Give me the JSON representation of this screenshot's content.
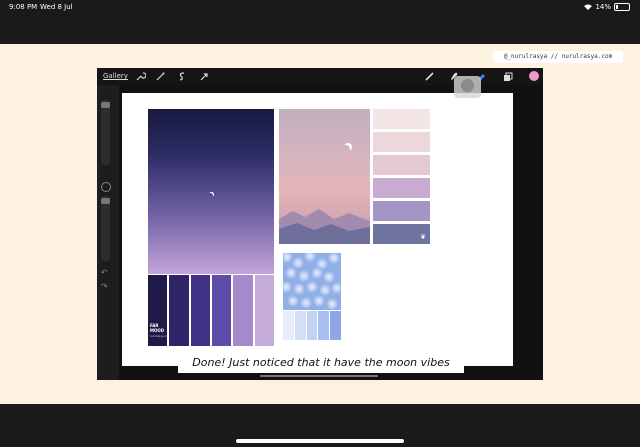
{
  "status_bar": {
    "time": "9:08 PM",
    "date": "Wed 8 Jul",
    "battery": "14%"
  },
  "credit": "@_nurulrasya // nurulrasya.com",
  "toolbar": {
    "gallery_label": "Gallery",
    "tools_left": [
      "wrench-icon",
      "magic-wand-icon",
      "selection-icon",
      "transform-arrow-icon"
    ],
    "tools_right": [
      "brush-icon",
      "smudge-icon",
      "eraser-icon",
      "layers-icon"
    ],
    "current_color": "#ec9cc9"
  },
  "moodboard": {
    "palette_strips": [
      "#1f1a48",
      "#2f2468",
      "#3f3186",
      "#5e4da8",
      "#a58bcb",
      "#c6add9"
    ],
    "badge_title": "FAR MOOD",
    "badge_subtitle": "nurulrasya.com",
    "swatches": [
      "#f3e4e6",
      "#edd7db",
      "#e5c9d2",
      "#c8abcf",
      "#a495c7",
      "#6f739f"
    ],
    "blue_strips": [
      "#e8ecfb",
      "#d4dff7",
      "#c3d1f4",
      "#a9bff0",
      "#8fa6e6"
    ]
  },
  "caption": "Done! Just noticed that it have the moon vibes"
}
